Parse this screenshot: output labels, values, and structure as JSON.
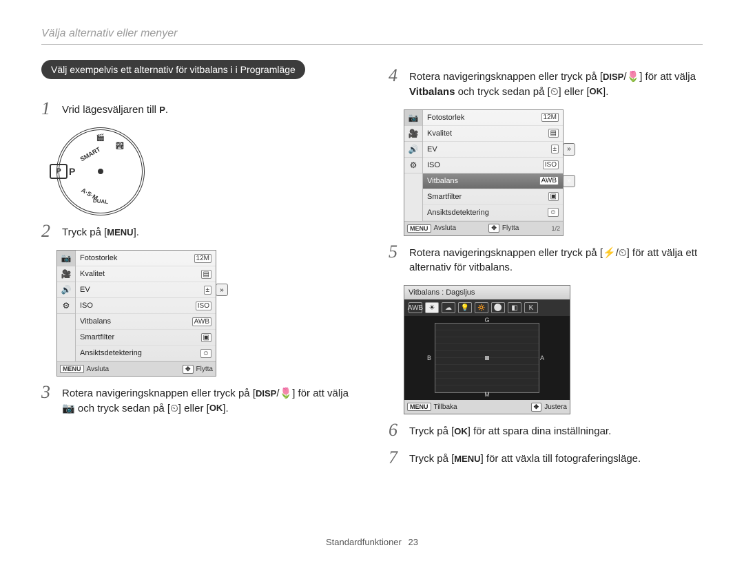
{
  "breadcrumb": "Välja alternativ eller menyer",
  "pill": "Välj exempelvis ett alternativ för vitbalans i i Programläge",
  "steps": {
    "1": {
      "pre": "Vrid lägesväljaren till ",
      "suffix": "P",
      "suffix_after": "."
    },
    "2": {
      "pre": "Tryck på [",
      "key": "MENU",
      "post": "]."
    },
    "3": {
      "text_a": "Rotera navigeringsknappen eller tryck på [",
      "disp": "DISP",
      "mid": "/",
      "flower": "🌷",
      "text_b": "] för att välja ",
      "cam": "📷",
      "text_c": " och tryck sedan på [",
      "timer": "⏲",
      "text_d": "] eller [",
      "ok": "OK",
      "text_e": "]."
    },
    "4": {
      "text_a": "Rotera navigeringsknappen eller tryck på [",
      "disp": "DISP",
      "mid": "/",
      "flower": "🌷",
      "text_b": "] för att välja ",
      "bold": "Vitbalans",
      "text_c": " och tryck sedan på [",
      "timer": "⏲",
      "text_d": "] eller [",
      "ok": "OK",
      "text_e": "]."
    },
    "5": {
      "text_a": "Rotera navigeringsknappen eller tryck på [",
      "flash": "⚡",
      "mid": "/",
      "timer": "⏲",
      "text_b": "] för att välja ett alternativ för vitbalans."
    },
    "6": {
      "text_a": "Tryck på [",
      "ok": "OK",
      "text_b": "] för att spara dina inställningar."
    },
    "7": {
      "text_a": "Tryck på [",
      "menu": "MENU",
      "text_b": "] för att växla till fotograferingsläge."
    }
  },
  "dial": {
    "p": "P",
    "smart": "SMART",
    "asm": "A·S·M",
    "dual": "DUAL",
    "movie": "🎬",
    "scene": "🏞"
  },
  "menu1": {
    "tabs": [
      "📷",
      "🎥",
      "🔊",
      "⚙"
    ],
    "rows": [
      {
        "label": "Fotostorlek",
        "badge": "12M"
      },
      {
        "label": "Kvalitet",
        "badge": "▤"
      },
      {
        "label": "EV",
        "badge": "±"
      },
      {
        "label": "ISO",
        "badge": "ISO"
      },
      {
        "label": "Vitbalans",
        "badge": "AWB"
      },
      {
        "label": "Smartfilter",
        "badge": "▣"
      },
      {
        "label": "Ansiktsdetektering",
        "badge": "☺"
      }
    ],
    "side1": "»",
    "footer": {
      "menu": "MENU",
      "exit": "Avsluta",
      "nav": "✥",
      "move": "Flytta"
    }
  },
  "menu2": {
    "tabs": [
      "📷",
      "🎥",
      "🔊",
      "⚙"
    ],
    "rows": [
      {
        "label": "Fotostorlek",
        "badge": "12M"
      },
      {
        "label": "Kvalitet",
        "badge": "▤"
      },
      {
        "label": "EV",
        "badge": "±"
      },
      {
        "label": "ISO",
        "badge": "ISO"
      },
      {
        "label": "Vitbalans",
        "badge": "AWB",
        "hi": true
      },
      {
        "label": "Smartfilter",
        "badge": "▣"
      },
      {
        "label": "Ansiktsdetektering",
        "badge": "☺"
      }
    ],
    "side1": "»",
    "side2": "»",
    "footer": {
      "menu": "MENU",
      "exit": "Avsluta",
      "nav": "✥",
      "move": "Flytta",
      "page": "1/2"
    }
  },
  "wb": {
    "title": "Vitbalans : Dagsljus",
    "options": [
      "AWB",
      "☀",
      "☁",
      "💡",
      "🔅",
      "⚪",
      "◧",
      "K"
    ],
    "selected": 1,
    "axes": {
      "g": "G",
      "b": "B",
      "a": "A",
      "m": "M"
    },
    "footer": {
      "menu": "MENU",
      "back": "Tillbaka",
      "nav": "✥",
      "adjust": "Justera"
    }
  },
  "footer": {
    "section": "Standardfunktioner",
    "page": "23"
  }
}
